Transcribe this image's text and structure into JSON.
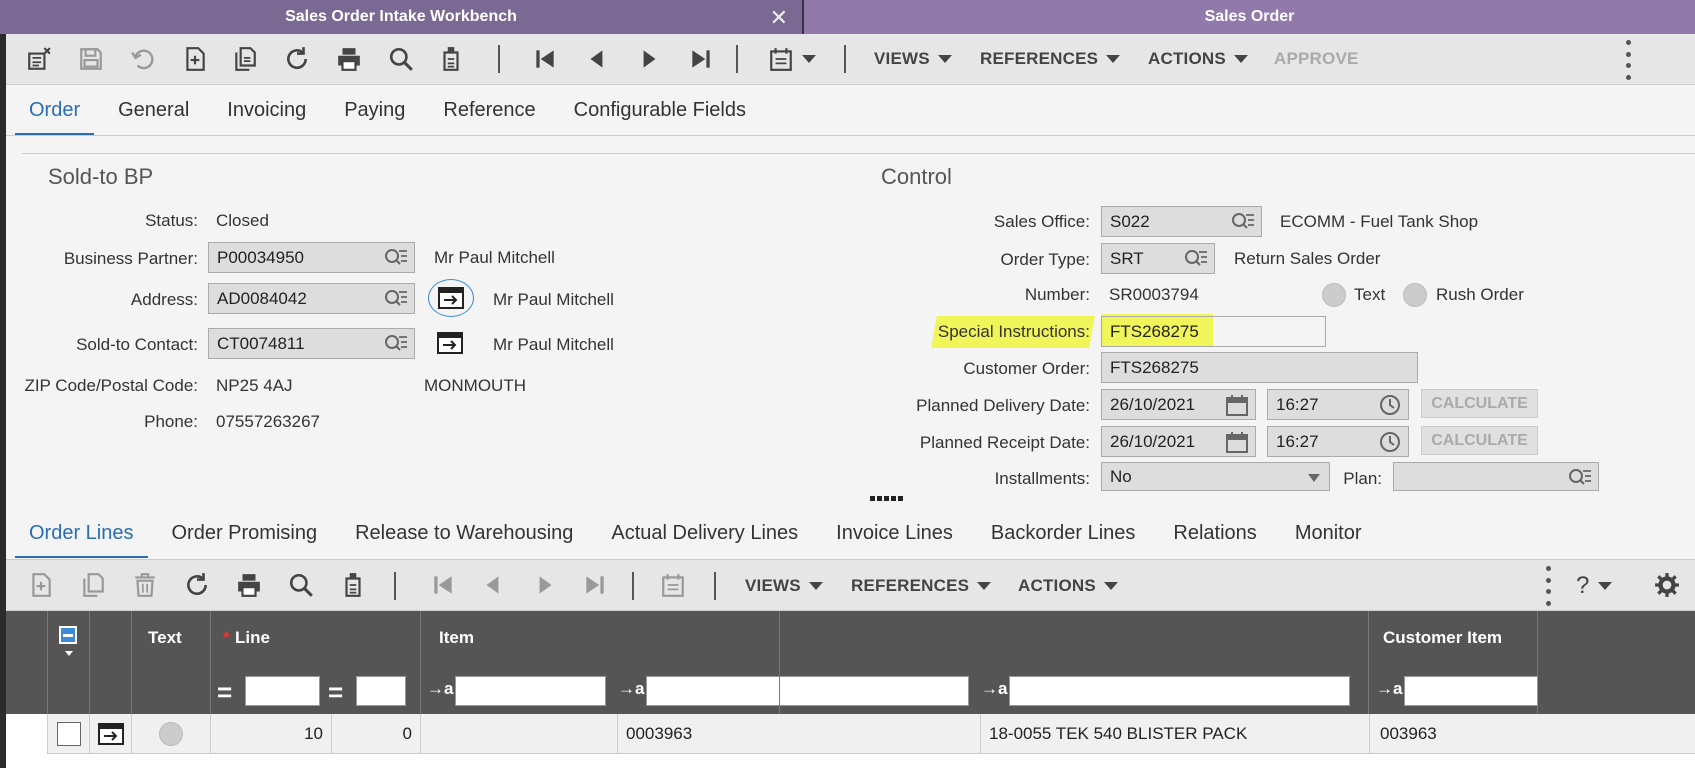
{
  "window_tabs": [
    {
      "label": "Sales Order Intake Workbench"
    },
    {
      "label": "Sales Order"
    }
  ],
  "toolbar": {
    "views": "VIEWS",
    "references": "REFERENCES",
    "actions": "ACTIONS",
    "approve": "APPROVE"
  },
  "header_tabs": [
    "Order",
    "General",
    "Invoicing",
    "Paying",
    "Reference",
    "Configurable Fields"
  ],
  "sold_to": {
    "title": "Sold-to BP",
    "status_label": "Status:",
    "status_value": "Closed",
    "bp_label": "Business Partner:",
    "bp_value": "P00034950",
    "bp_name": "Mr Paul Mitchell",
    "address_label": "Address:",
    "address_value": "AD0084042",
    "address_name": "Mr Paul Mitchell",
    "contact_label": "Sold-to Contact:",
    "contact_value": "CT0074811",
    "contact_name": "Mr Paul Mitchell",
    "zip_label": "ZIP Code/Postal Code:",
    "zip_value": "NP25 4AJ",
    "city_value": "MONMOUTH",
    "phone_label": "Phone:",
    "phone_value": "07557263267"
  },
  "control": {
    "title": "Control",
    "sales_office_label": "Sales Office:",
    "sales_office_value": "S022",
    "sales_office_desc": "ECOMM - Fuel Tank Shop",
    "order_type_label": "Order Type:",
    "order_type_value": "SRT",
    "order_type_desc": "Return Sales Order",
    "number_label": "Number:",
    "number_value": "SR0003794",
    "text_label": "Text",
    "rush_label": "Rush Order",
    "special_label": "Special Instructions:",
    "special_value": "FTS268275",
    "customer_order_label": "Customer Order:",
    "customer_order_value": "FTS268275",
    "planned_delivery_label": "Planned Delivery Date:",
    "planned_delivery_date": "26/10/2021",
    "planned_delivery_time": "16:27",
    "planned_receipt_label": "Planned Receipt Date:",
    "planned_receipt_date": "26/10/2021",
    "planned_receipt_time": "16:27",
    "calculate": "CALCULATE",
    "installments_label": "Installments:",
    "installments_value": "No",
    "plan_label": "Plan:"
  },
  "line_tabs": [
    "Order Lines",
    "Order Promising",
    "Release to Warehousing",
    "Actual Delivery Lines",
    "Invoice Lines",
    "Backorder Lines",
    "Relations",
    "Monitor"
  ],
  "toolbar2": {
    "views": "VIEWS",
    "references": "REFERENCES",
    "actions": "ACTIONS",
    "help": "?"
  },
  "grid": {
    "col_text": "Text",
    "col_line": "Line",
    "required_mark": "*",
    "col_item": "Item",
    "col_customer_item": "Customer Item",
    "eq": "=",
    "arrow_a": "→a"
  },
  "rows": [
    {
      "line": "10",
      "seq": "0",
      "item_seg": "0003963",
      "item_desc": "18-0055 TEK 540 BLISTER PACK",
      "customer_item": "003963"
    }
  ],
  "colors": {
    "accent": "#2a6db5",
    "tab_bg": "#7a6a93",
    "highlight": "#f0f55a"
  }
}
